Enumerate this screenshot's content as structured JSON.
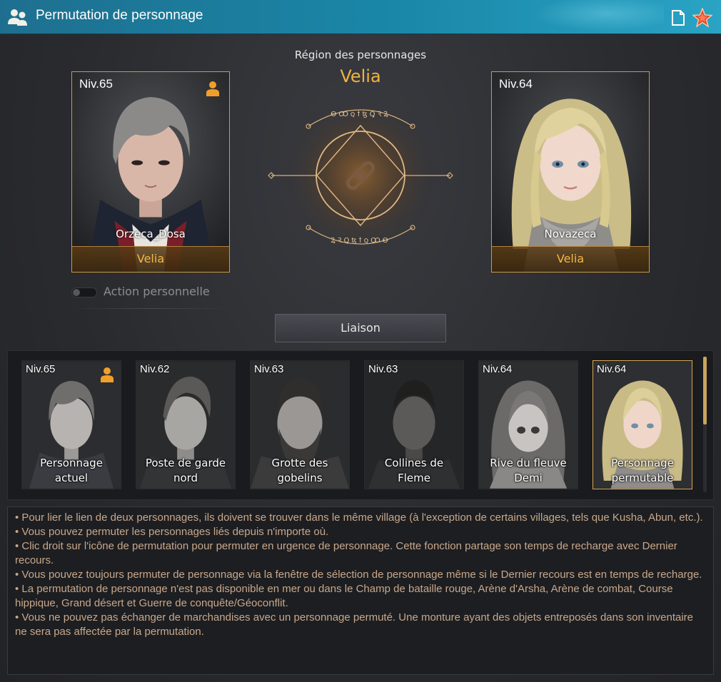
{
  "window": {
    "title": "Permutation de personnage"
  },
  "region": {
    "label": "Région des personnages",
    "name": "Velia"
  },
  "left_character": {
    "level": "Niv.65",
    "name": "Orzeca_Dosa",
    "location": "Velia",
    "is_current": true
  },
  "right_character": {
    "level": "Niv.64",
    "name": "Novazeca",
    "location": "Velia"
  },
  "toggle": {
    "label": "Action personnelle",
    "on": false
  },
  "liaison_button": "Liaison",
  "characters": [
    {
      "level": "Niv.65",
      "label": "Personnage actuel",
      "current": true
    },
    {
      "level": "Niv.62",
      "label": "Poste de garde nord"
    },
    {
      "level": "Niv.63",
      "label": "Grotte des gobelins"
    },
    {
      "level": "Niv.63",
      "label": "Collines de Fleme"
    },
    {
      "level": "Niv.64",
      "label": "Rive du fleuve Demi"
    },
    {
      "level": "Niv.64",
      "label": "Personnage permutable",
      "selected": true
    }
  ],
  "info_lines": [
    "• Pour lier le lien de deux personnages, ils doivent se trouver dans le même village (à l'exception de certains villages, tels que Kusha, Abun, etc.).",
    "• Vous pouvez permuter les personnages liés depuis n'importe où.",
    "• Clic droit sur l'icône de permutation pour permuter en urgence de personnage. Cette fonction partage son temps de recharge avec Dernier recours.",
    "• Vous pouvez toujours permuter de personnage via la fenêtre de sélection de personnage même si le Dernier recours est en temps de recharge.",
    "• La permutation de personnage n'est pas disponible en mer ou dans le Champ de bataille rouge, Arène d'Arsha, Arène de combat, Course hippique, Grand désert et Guerre de conquête/Géoconflit.",
    "• Vous ne pouvez pas échanger de marchandises avec un personnage permuté. Une monture ayant des objets entreposés dans son inventaire ne sera pas affectée par la permutation."
  ],
  "colors": {
    "accent_gold": "#f0b340",
    "title_bar": "#1a87a8",
    "info_text": "#c8a88c"
  }
}
